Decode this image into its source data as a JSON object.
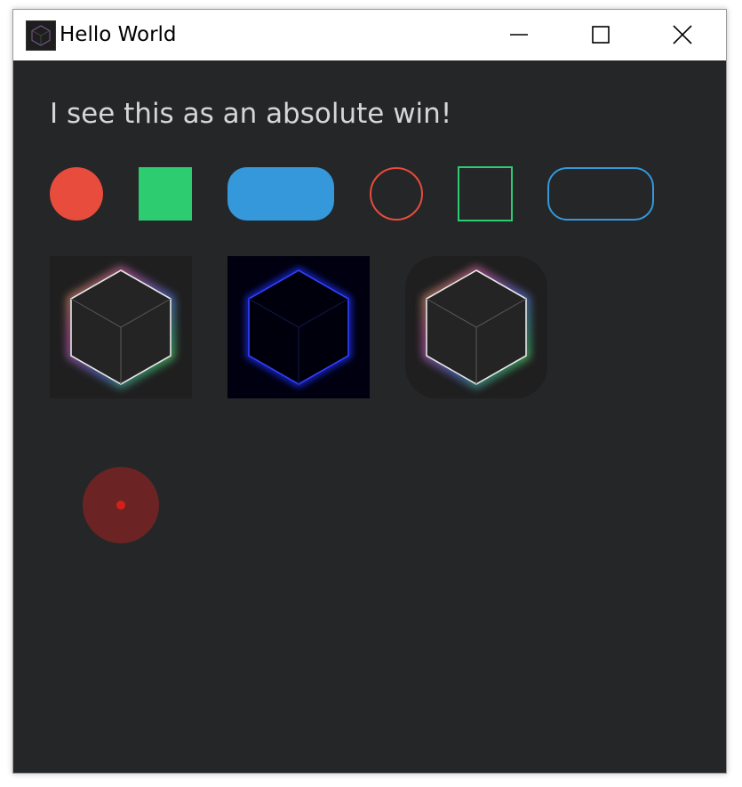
{
  "window": {
    "title": "Hello World",
    "app_icon": "cube-icon",
    "controls": [
      "minimize-icon",
      "maximize-icon",
      "close-icon"
    ]
  },
  "main": {
    "headline": "I see this as an absolute win!",
    "shapes": [
      {
        "name": "filled-circle",
        "color": "#e74c3c"
      },
      {
        "name": "filled-square",
        "color": "#2ecc71"
      },
      {
        "name": "filled-pill",
        "color": "#3498db"
      },
      {
        "name": "outlined-circle",
        "color": "#e74c3c"
      },
      {
        "name": "outlined-square",
        "color": "#2ecc71"
      },
      {
        "name": "outlined-pill",
        "color": "#3498db"
      }
    ],
    "cube_tiles": [
      {
        "name": "cube-icon-rainbow-glow"
      },
      {
        "name": "cube-icon-blue-glow"
      },
      {
        "name": "cube-icon-rainbow-glow-rounded"
      }
    ],
    "indicator": {
      "name": "red-dot-indicator",
      "outer_color": "#6b2423",
      "inner_color": "#d4201b"
    }
  },
  "colors": {
    "background": "#252628",
    "text": "#d6d6d6"
  }
}
